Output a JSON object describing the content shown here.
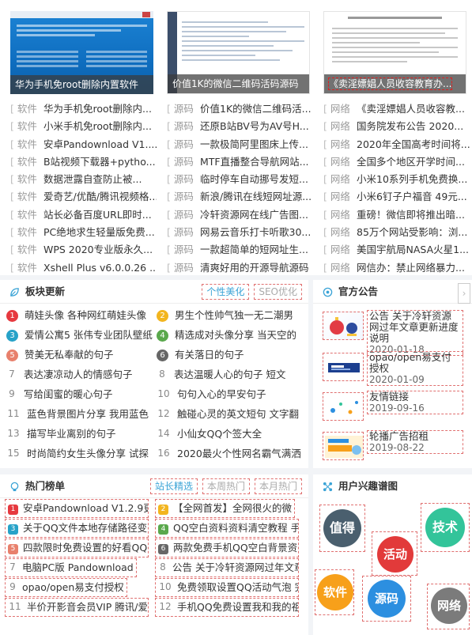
{
  "columns": [
    {
      "caption": "华为手机免root删除内置软件",
      "items": [
        {
          "cat": "软件",
          "title": "华为手机免root删除内..."
        },
        {
          "cat": "软件",
          "title": "小米手机免root删除内..."
        },
        {
          "cat": "软件",
          "title": "安卓Pandownload V1...."
        },
        {
          "cat": "软件",
          "title": "B站视频下载器+pytho..."
        },
        {
          "cat": "软件",
          "title": "数据泄露自查防止被..."
        },
        {
          "cat": "软件",
          "title": "爱奇艺/优酷/腾讯视频格..."
        },
        {
          "cat": "软件",
          "title": "站长必备百度URL即时..."
        },
        {
          "cat": "软件",
          "title": "PC绝地求生轻量版免费..."
        },
        {
          "cat": "软件",
          "title": "WPS 2020专业版永久..."
        },
        {
          "cat": "软件",
          "title": "Xshell Plus v6.0.0.26 ..."
        }
      ]
    },
    {
      "caption": "价值1K的微信二维码活码源码",
      "items": [
        {
          "cat": "源码",
          "title": "价值1K的微信二维码活..."
        },
        {
          "cat": "源码",
          "title": "还原B站BV号为AV号H..."
        },
        {
          "cat": "源码",
          "title": "一款极简阿里图床上传..."
        },
        {
          "cat": "源码",
          "title": "MTF直播整合导航网站..."
        },
        {
          "cat": "源码",
          "title": "临时停车自动挪号发短..."
        },
        {
          "cat": "源码",
          "title": "新浪/腾讯在线短网址源..."
        },
        {
          "cat": "源码",
          "title": "冷轩资源网在线广告图..."
        },
        {
          "cat": "源码",
          "title": "网易云音乐打卡听歌30..."
        },
        {
          "cat": "源码",
          "title": "一款超简单的短网址生..."
        },
        {
          "cat": "源码",
          "title": "清爽好用的开源导航源码"
        }
      ]
    },
    {
      "caption": "《卖淫嫖娼人员收容教育办...",
      "items": [
        {
          "cat": "网络",
          "title": "《卖淫嫖娼人员收容教..."
        },
        {
          "cat": "网络",
          "title": "国务院发布公告 2020..."
        },
        {
          "cat": "网络",
          "title": "2020年全国高考时间将..."
        },
        {
          "cat": "网络",
          "title": "全国多个地区开学时间..."
        },
        {
          "cat": "网络",
          "title": "小米10系列手机免费换..."
        },
        {
          "cat": "网络",
          "title": "小米6钉子户福音 49元..."
        },
        {
          "cat": "网络",
          "title": "重磅！微信即将推出暗..."
        },
        {
          "cat": "网络",
          "title": "85万个网站受影响：浏..."
        },
        {
          "cat": "网络",
          "title": "美国宇航局NASA火星1..."
        },
        {
          "cat": "网络",
          "title": "网信办：禁止网络暴力..."
        }
      ]
    }
  ],
  "block_update": {
    "title": "板块更新",
    "tabs": [
      "个性美化",
      "SEO优化"
    ],
    "items": [
      {
        "n": "1",
        "text": "萌娃头像 各种网红萌娃头像"
      },
      {
        "n": "2",
        "text": "男生个性帅气独一无二潮男"
      },
      {
        "n": "3",
        "text": "爱情公寓5 张伟专业团队壁纸"
      },
      {
        "n": "4",
        "text": "精选成对头像分享 当天空的"
      },
      {
        "n": "5",
        "text": "赞美无私奉献的句子"
      },
      {
        "n": "6",
        "text": "有关落日的句子"
      },
      {
        "n": "7",
        "text": "表达凄凉动人的情感句子"
      },
      {
        "n": "8",
        "text": "表达温暖人心的句子 短文"
      },
      {
        "n": "9",
        "text": "写给闺蜜的暖心句子"
      },
      {
        "n": "10",
        "text": "句句入心的早安句子"
      },
      {
        "n": "11",
        "text": "蓝色背景图片分享 我用蓝色"
      },
      {
        "n": "12",
        "text": "触碰心灵的英文短句 文字翻"
      },
      {
        "n": "13",
        "text": "描写毕业离别的句子"
      },
      {
        "n": "14",
        "text": "小仙女QQ个签大全"
      },
      {
        "n": "15",
        "text": "时尚简约女生头像分享 试探"
      },
      {
        "n": "16",
        "text": "2020最火个性网名霸气满洒"
      }
    ]
  },
  "notice": {
    "title": "官方公告",
    "scroll": "›",
    "items": [
      {
        "title": "公告 关于冷轩资源网过年文章更新进度说明",
        "date": "2020-01-18"
      },
      {
        "title": "opao/open易支付授权",
        "date": "2020-01-09"
      },
      {
        "title": "友情链接",
        "date": "2019-09-16"
      },
      {
        "title": "轮播广告招租",
        "date": "2019-08-22"
      }
    ]
  },
  "hot": {
    "title": "热门榜单",
    "tabs": [
      "站长精选",
      "本周热门",
      "本月热门"
    ],
    "items": [
      {
        "n": "1",
        "text": "安卓Pandownload V1.2.9更"
      },
      {
        "n": "2",
        "text": "【全网首发】全网很火的微"
      },
      {
        "n": "3",
        "text": "关于QQ文件本地存储路径变"
      },
      {
        "n": "4",
        "text": "QQ空白资料资料清空教程 手"
      },
      {
        "n": "5",
        "text": "四款限时免费设置的好看QQ"
      },
      {
        "n": "6",
        "text": "两款免费手机QQ空白背景资"
      },
      {
        "n": "7",
        "text": "电脑PC版 Pandownload"
      },
      {
        "n": "8",
        "text": "公告 关于冷轩资源网过年文章"
      },
      {
        "n": "9",
        "text": "opao/open易支付授权"
      },
      {
        "n": "10",
        "text": "免费领取设置QQ活动气泡 完"
      },
      {
        "n": "11",
        "text": "半价开影音会员VIP 腾讯/爱奇"
      },
      {
        "n": "12",
        "text": "手机QQ免费设置我和我的祖"
      }
    ]
  },
  "tags": {
    "title": "用户兴趣谱图",
    "items": [
      "值得",
      "技术",
      "活动",
      "软件",
      "源码",
      "网络"
    ],
    "colors": [
      "#4a5f6e",
      "#33c49a",
      "#e23a3a",
      "#f7a01a",
      "#2c8fe0",
      "#7b7b7b"
    ]
  }
}
